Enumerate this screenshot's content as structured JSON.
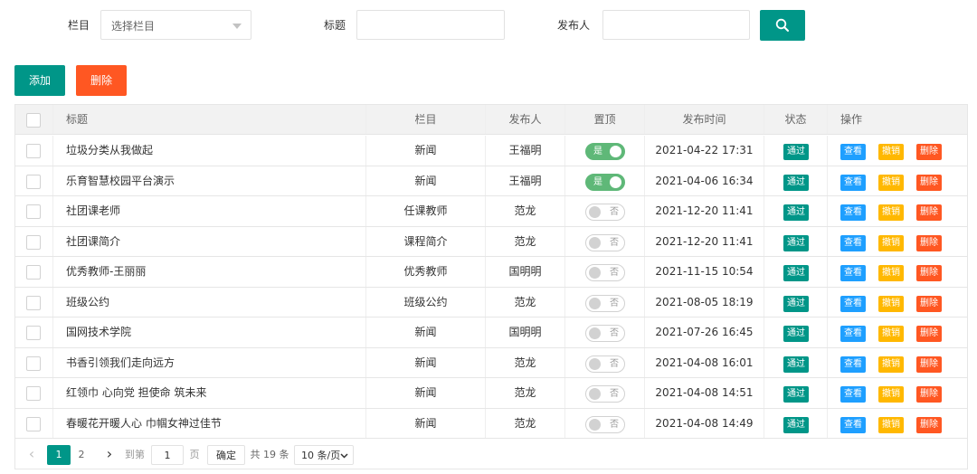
{
  "filters": {
    "column_label": "栏目",
    "column_placeholder": "选择栏目",
    "title_label": "标题",
    "title_value": "",
    "publisher_label": "发布人",
    "publisher_value": "",
    "search_icon": "search-icon"
  },
  "actions": {
    "add_label": "添加",
    "delete_label": "删除"
  },
  "colors": {
    "primary": "#009688",
    "danger": "#ff5722",
    "normal": "#1e9fff",
    "warm": "#ffb800",
    "switch_on": "#5fb878"
  },
  "table": {
    "columns": [
      "标题",
      "栏目",
      "发布人",
      "置顶",
      "发布时间",
      "状态",
      "操作"
    ],
    "switch_on_text": "是",
    "switch_off_text": "否",
    "action_view": "查看",
    "action_revoke": "撤销",
    "action_delete": "删除",
    "rows": [
      {
        "title": "垃圾分类从我做起",
        "column": "新闻",
        "publisher": "王福明",
        "pinned": true,
        "time": "2021-04-22 17:31",
        "status": "通过"
      },
      {
        "title": "乐育智慧校园平台演示",
        "column": "新闻",
        "publisher": "王福明",
        "pinned": true,
        "time": "2021-04-06 16:34",
        "status": "通过"
      },
      {
        "title": "社团课老师",
        "column": "任课教师",
        "publisher": "范龙",
        "pinned": false,
        "time": "2021-12-20 11:41",
        "status": "通过"
      },
      {
        "title": "社团课简介",
        "column": "课程简介",
        "publisher": "范龙",
        "pinned": false,
        "time": "2021-12-20 11:41",
        "status": "通过"
      },
      {
        "title": "优秀教师-王丽丽",
        "column": "优秀教师",
        "publisher": "国明明",
        "pinned": false,
        "time": "2021-11-15 10:54",
        "status": "通过"
      },
      {
        "title": "班级公约",
        "column": "班级公约",
        "publisher": "范龙",
        "pinned": false,
        "time": "2021-08-05 18:19",
        "status": "通过"
      },
      {
        "title": "国网技术学院",
        "column": "新闻",
        "publisher": "国明明",
        "pinned": false,
        "time": "2021-07-26 16:45",
        "status": "通过"
      },
      {
        "title": "书香引领我们走向远方",
        "column": "新闻",
        "publisher": "范龙",
        "pinned": false,
        "time": "2021-04-08 16:01",
        "status": "通过"
      },
      {
        "title": "红领巾 心向党 担使命 筑未来",
        "column": "新闻",
        "publisher": "范龙",
        "pinned": false,
        "time": "2021-04-08 14:51",
        "status": "通过"
      },
      {
        "title": "春暖花开暖人心 巾帼女神过佳节",
        "column": "新闻",
        "publisher": "范龙",
        "pinned": false,
        "time": "2021-04-08 14:49",
        "status": "通过"
      }
    ]
  },
  "pagination": {
    "prev": "‹",
    "next": "›",
    "pages": [
      "1",
      "2"
    ],
    "current_page": "1",
    "goto_label": "到第",
    "goto_value": "1",
    "page_unit": "页",
    "confirm": "确定",
    "total": "共 19 条",
    "page_size": "10 条/页"
  }
}
